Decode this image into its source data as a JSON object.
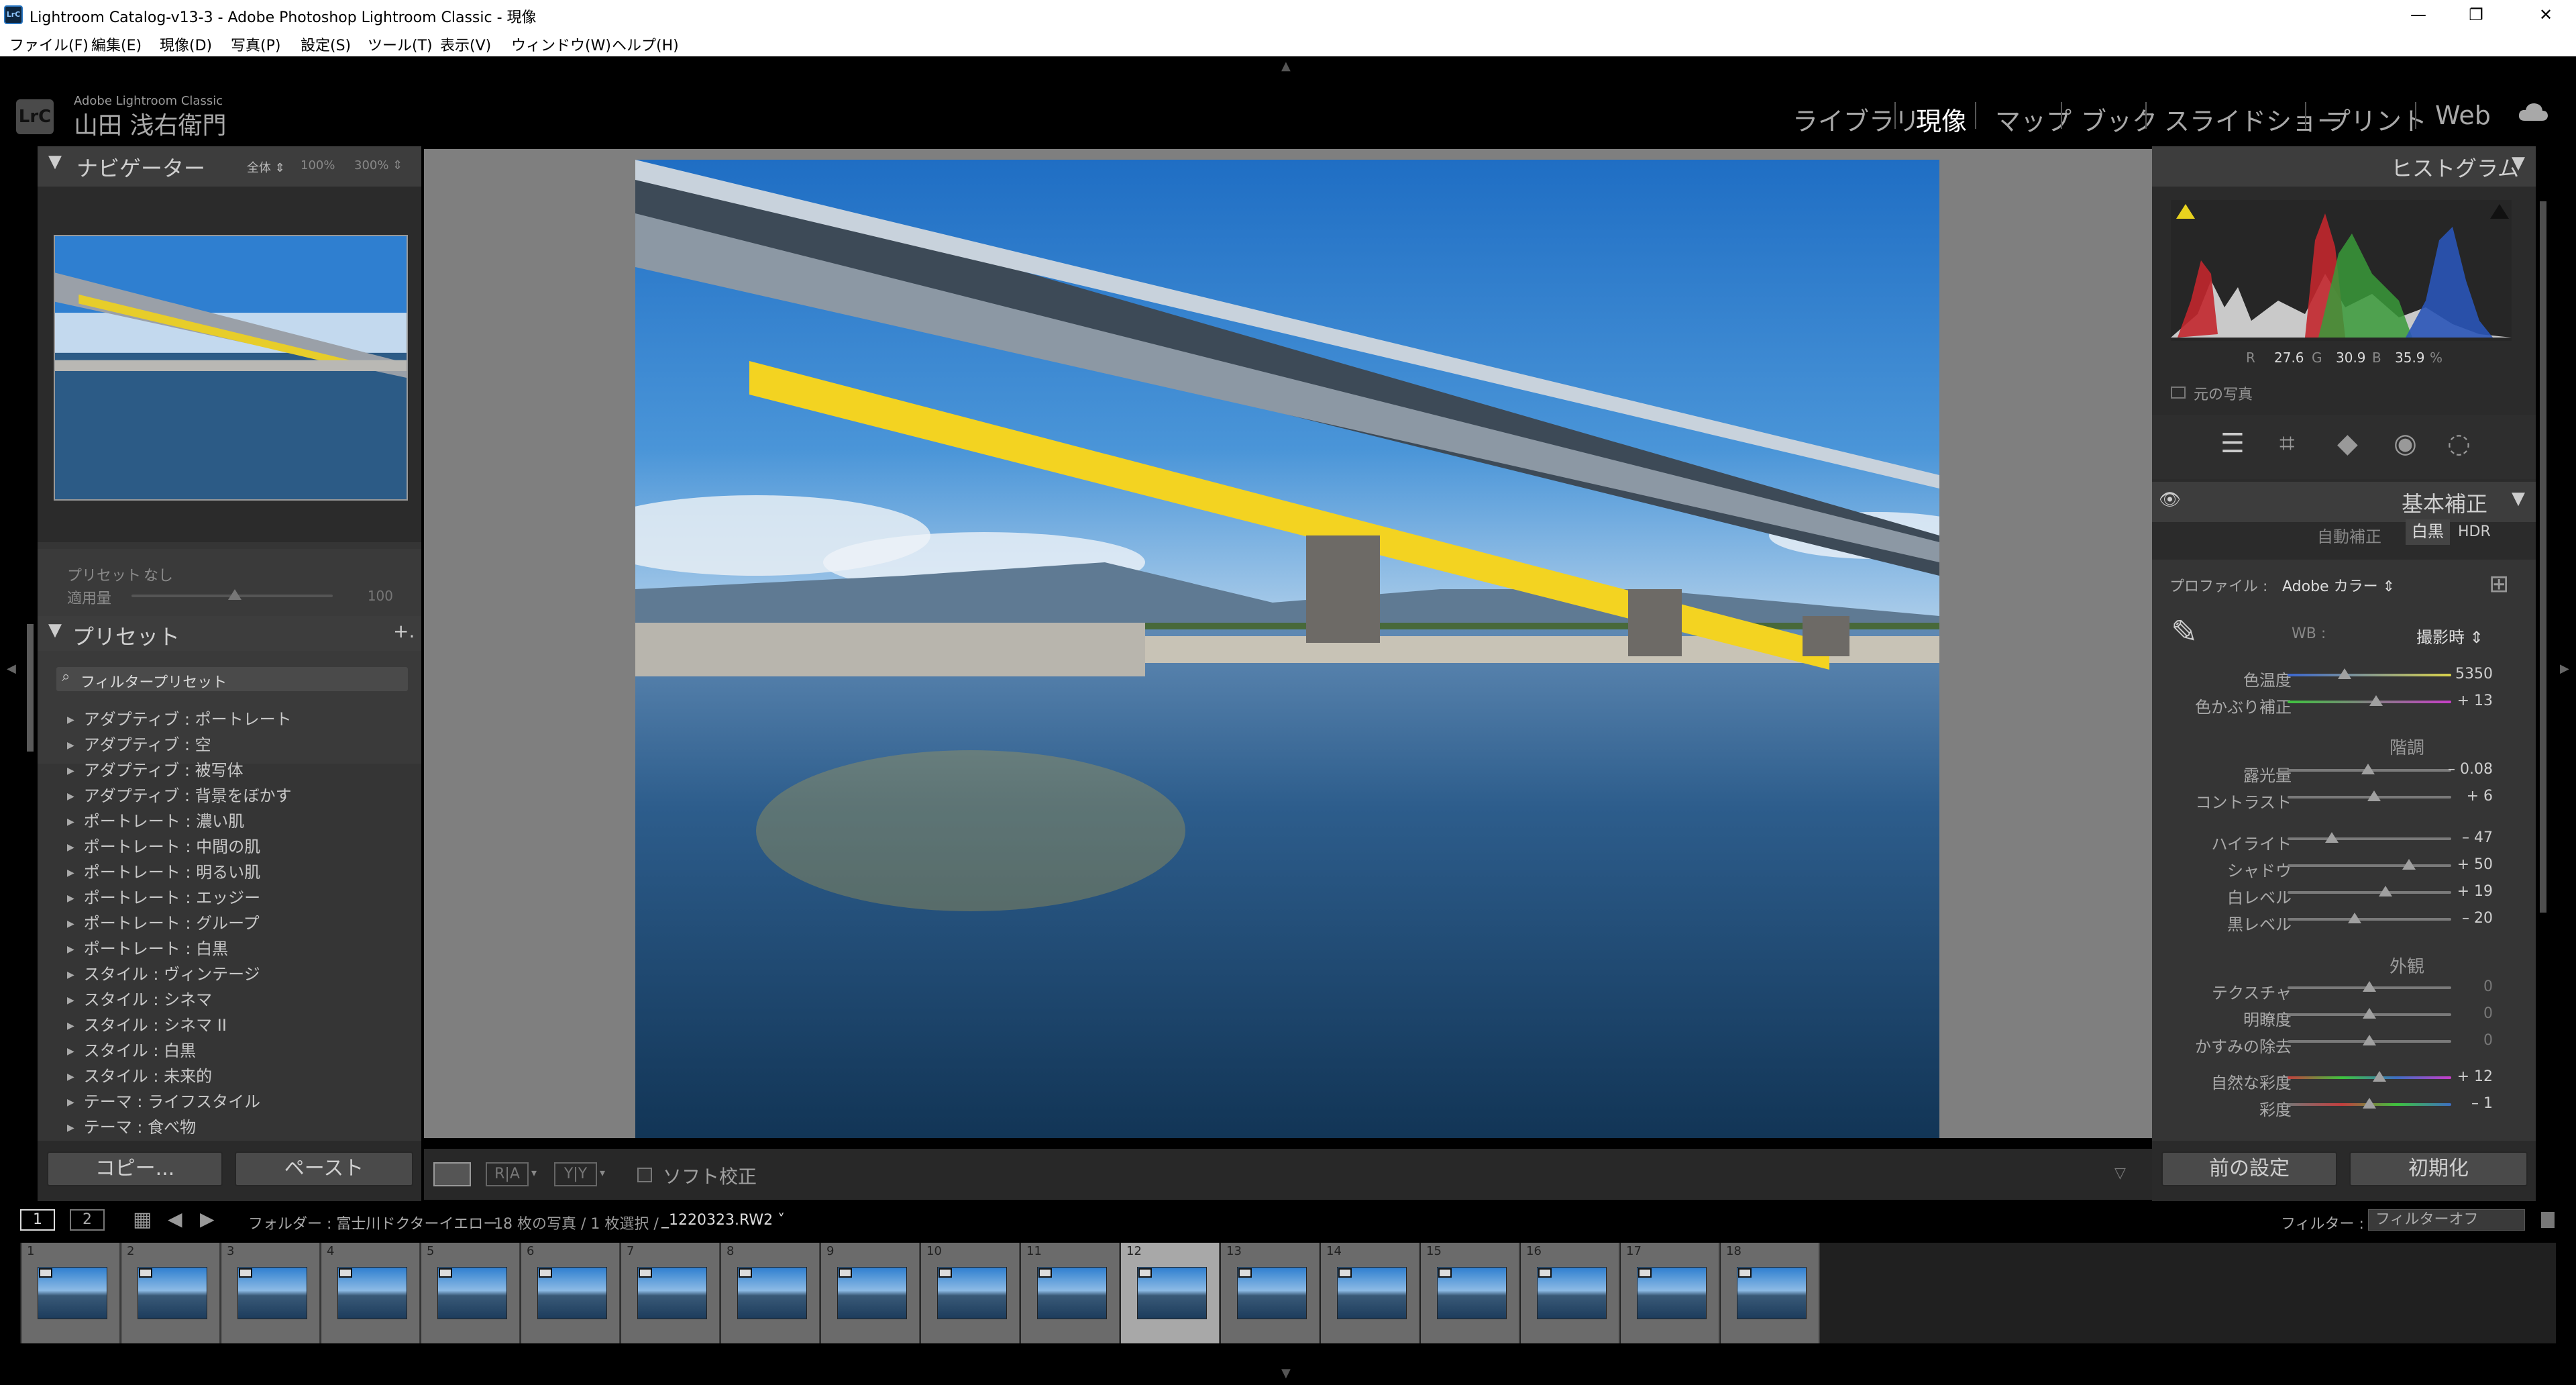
{
  "window": {
    "title": "Lightroom Catalog-v13-3 - Adobe Photoshop Lightroom Classic - 現像",
    "app_icon": "LrC"
  },
  "menu": [
    "ファイル(F)",
    "編集(E)",
    "現像(D)",
    "写真(P)",
    "設定(S)",
    "ツール(T)",
    "表示(V)",
    "ウィンドウ(W)",
    "ヘルプ(H)"
  ],
  "identity": {
    "logo": "LrC",
    "product": "Adobe Lightroom Classic",
    "user": "山田 浅右衛門"
  },
  "modules": [
    "ライブラリ",
    "現像",
    "マップ",
    "ブック",
    "スライドショー",
    "プリント",
    "Web"
  ],
  "active_module": "現像",
  "navigator": {
    "title": "ナビゲーター",
    "zoom": [
      "全体 ⇕",
      "100%",
      "300% ⇕"
    ]
  },
  "preset_amount": {
    "preset_label": "プリセット :",
    "preset_value": "なし",
    "amount_label": "適用量",
    "amount_value": "100"
  },
  "presets": {
    "title": "プリセット",
    "add": "+.",
    "filter": "フィルタープリセット",
    "items": [
      "アダプティブ : ポートレート",
      "アダプティブ : 空",
      "アダプティブ : 被写体",
      "アダプティブ : 背景をぼかす",
      "ポートレート : 濃い肌",
      "ポートレート : 中間の肌",
      "ポートレート : 明るい肌",
      "ポートレート : エッジー",
      "ポートレート : グループ",
      "ポートレート : 白黒",
      "スタイル : ヴィンテージ",
      "スタイル : シネマ",
      "スタイル : シネマ II",
      "スタイル : 白黒",
      "スタイル : 未来的",
      "テーマ : ライフスタイル",
      "テーマ : 食べ物"
    ]
  },
  "left_buttons": {
    "copy": "コピー...",
    "paste": "ペースト"
  },
  "toolbar": {
    "soft_proof": "ソフト校正"
  },
  "histogram": {
    "title": "ヒストグラム",
    "r_label": "R",
    "r": "27.6",
    "g_label": "G",
    "g": "30.9",
    "b_label": "B",
    "b": "35.9",
    "unit": "%",
    "original": "元の写真"
  },
  "basic": {
    "title": "基本補正",
    "auto": "自動補正",
    "bw": "白黒",
    "hdr": "HDR",
    "profile_label": "プロファイル :",
    "profile_value": "Adobe カラー ⇕",
    "wb_label": "WB :",
    "wb_value": "撮影時 ⇕",
    "tone_header": "階調",
    "presence_header": "外観",
    "sliders": [
      {
        "label": "色温度",
        "value": "5350",
        "pos": 0.35
      },
      {
        "label": "色かぶり補正",
        "value": "+ 13",
        "pos": 0.54
      },
      {
        "label": "露光量",
        "value": "– 0.08",
        "pos": 0.49
      },
      {
        "label": "コントラスト",
        "value": "+ 6",
        "pos": 0.53
      },
      {
        "label": "ハイライト",
        "value": "– 47",
        "pos": 0.27
      },
      {
        "label": "シャドウ",
        "value": "+ 50",
        "pos": 0.74
      },
      {
        "label": "白レベル",
        "value": "+ 19",
        "pos": 0.6
      },
      {
        "label": "黒レベル",
        "value": "– 20",
        "pos": 0.41
      },
      {
        "label": "テクスチャ",
        "value": "0",
        "pos": 0.5
      },
      {
        "label": "明瞭度",
        "value": "0",
        "pos": 0.5
      },
      {
        "label": "かすみの除去",
        "value": "0",
        "pos": 0.5
      },
      {
        "label": "自然な彩度",
        "value": "+ 12",
        "pos": 0.56
      },
      {
        "label": "彩度",
        "value": "– 1",
        "pos": 0.5
      }
    ]
  },
  "right_buttons": {
    "previous": "前の設定",
    "reset": "初期化"
  },
  "filmbar": {
    "view1": "1",
    "view2": "2",
    "path": "フォルダー : 富士川ドクターイエロー",
    "count": "18 枚の写真 / 1 枚選択 /",
    "file": "_1220323.RW2 ˅",
    "filter_label": "フィルター :",
    "filter_value": "フィルターオフ"
  },
  "filmstrip": {
    "numbers": [
      "1",
      "2",
      "3",
      "4",
      "5",
      "6",
      "7",
      "8",
      "9",
      "10",
      "11",
      "12",
      "13",
      "14",
      "15",
      "16",
      "17",
      "18"
    ],
    "selected": "12"
  }
}
